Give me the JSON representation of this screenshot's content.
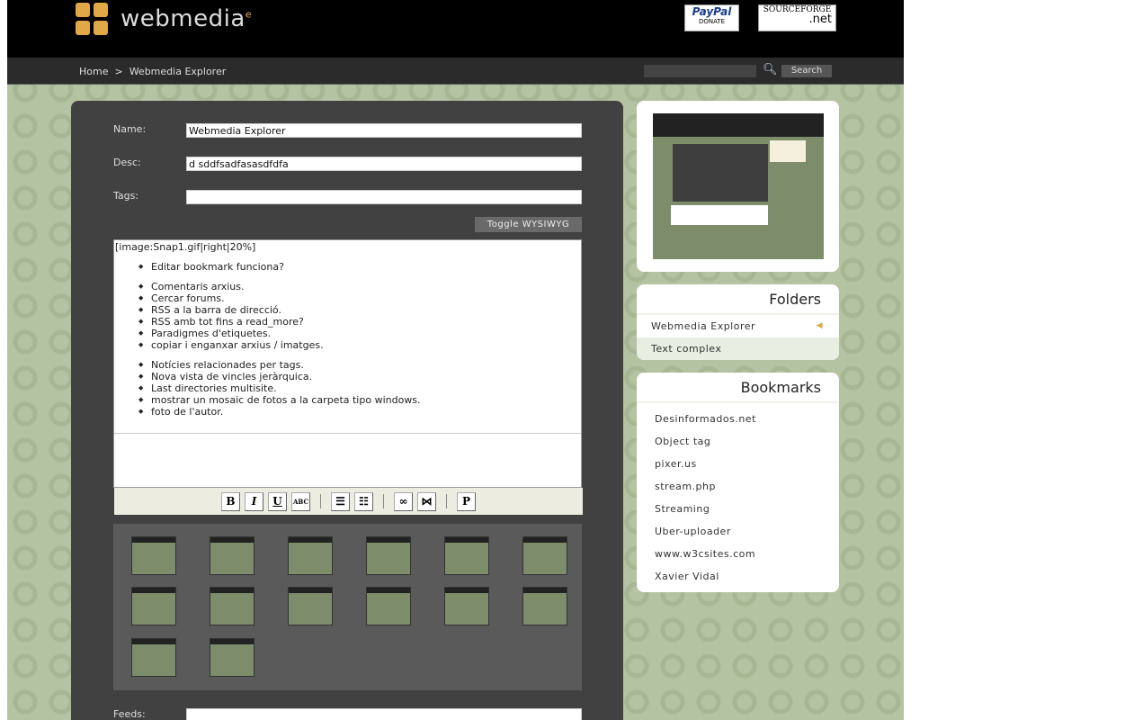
{
  "header": {
    "logo_text": "webmedia",
    "logo_sup": "e",
    "paypal": "PayPal",
    "paypal_sub": "DONATE",
    "sourceforge": "SOURCEFORGE",
    "sourceforge_sub": ".net"
  },
  "nav": {
    "breadcrumb": [
      "Home",
      "Webmedia Explorer"
    ],
    "separator": ">",
    "search_value": "",
    "search_label": "Search"
  },
  "form": {
    "name_label": "Name:",
    "name_value": "Webmedia Explorer",
    "desc_label": "Desc:",
    "desc_value": "d sddfsadfasasdfdfa",
    "tags_label": "Tags:",
    "tags_value": "",
    "toggle_label": "Toggle WYSIWYG",
    "feeds_label": "Feeds:"
  },
  "editor": {
    "first_line": "[image:Snap1.gif|right|20%]",
    "groups": [
      [
        "Editar bookmark funciona?"
      ],
      [
        "Comentaris arxius.",
        "Cercar forums.",
        "RSS a la barra de direcció.",
        "RSS amb tot fins a read_more?",
        "Paradigmes d'etiquetes.",
        "copiar i enganxar arxius / imatges."
      ],
      [
        "Notícies relacionades per tags.",
        "Nova vista de vincles jeràrquica.",
        "Last directories multisite.",
        "mostrar un mosaic de fotos a la carpeta tipo windows.",
        "foto de l'autor."
      ]
    ],
    "toolbar": [
      {
        "icon": "bold-icon",
        "glyph": "B"
      },
      {
        "icon": "italic-icon",
        "glyph": "I"
      },
      {
        "icon": "underline-icon",
        "glyph": "U"
      },
      {
        "icon": "strikethrough-icon",
        "glyph": "ABC"
      },
      {
        "sep": true
      },
      {
        "icon": "bullet-list-icon",
        "glyph": "☰"
      },
      {
        "icon": "numbered-list-icon",
        "glyph": "☷"
      },
      {
        "sep": true
      },
      {
        "icon": "link-icon",
        "glyph": "∞"
      },
      {
        "icon": "unlink-icon",
        "glyph": "⋈"
      },
      {
        "sep": true
      },
      {
        "icon": "paragraph-icon",
        "glyph": "P"
      }
    ]
  },
  "thumbnail_count": 14,
  "folders": {
    "title": "Folders",
    "items": [
      "Webmedia Explorer",
      "Text complex"
    ]
  },
  "bookmarks": {
    "title": "Bookmarks",
    "items": [
      "Desinformados.net",
      "Object tag",
      "pixer.us",
      "stream.php",
      "Streaming",
      "Uber-uploader",
      "www.w3csites.com",
      "Xavier Vidal"
    ]
  },
  "colors": {
    "accent": "#e0a847",
    "background": "#b4c3a2",
    "panel": "#414141"
  }
}
